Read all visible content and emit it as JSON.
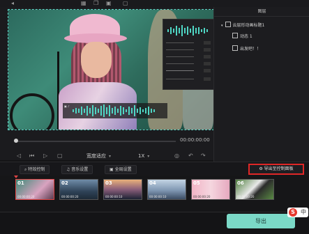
{
  "timecode": "00:00:00:00",
  "ratio": "宽度适应",
  "speed": "1X",
  "layers": {
    "title": "图层",
    "group": "云层形动画标题1",
    "item1": "动态 1",
    "item2": "出发吧！！"
  },
  "tabs": {
    "animation": "特效控制",
    "audio": "音乐设置",
    "global": "全局设置",
    "export_board": "导出至控制面板"
  },
  "clips": [
    {
      "num": "01",
      "dur": "00:00:00:20"
    },
    {
      "num": "02",
      "dur": "00:00:00:20"
    },
    {
      "num": "03",
      "dur": "00:00:00:10"
    },
    {
      "num": "04",
      "dur": "00:00:00:10"
    },
    {
      "num": "05",
      "dur": "00:00:00:20"
    },
    {
      "num": "06",
      "dur": "00:00:00:20"
    }
  ],
  "export_button": "导出",
  "ime_label": "中",
  "accent": "#7bd9c7"
}
